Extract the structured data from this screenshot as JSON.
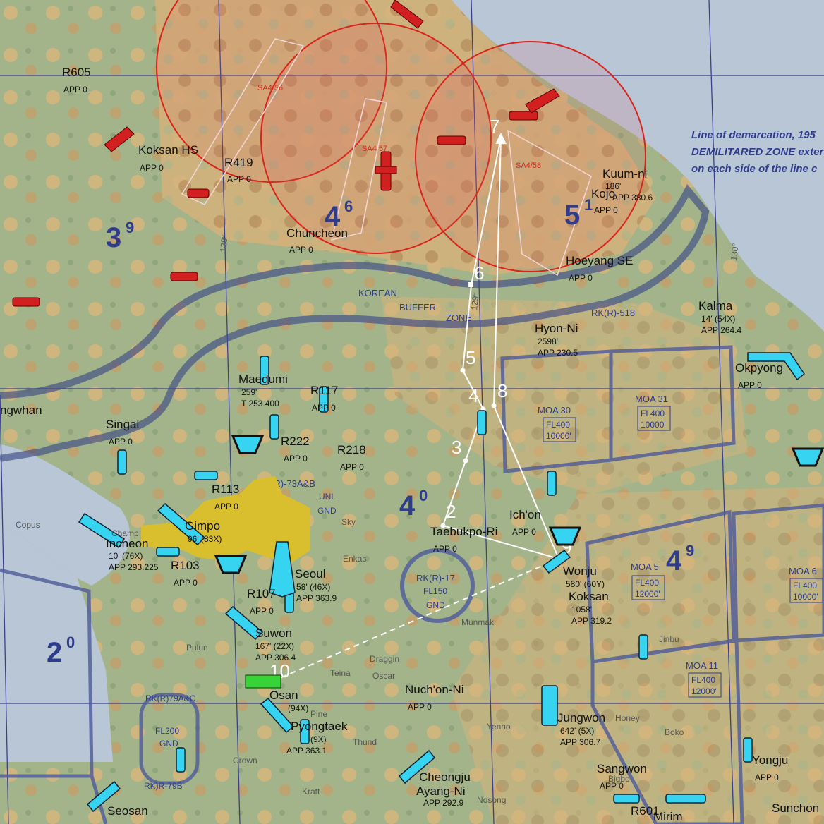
{
  "dmz_note": [
    "Line of demarcation, 195",
    "DEMILITARED ZONE exter",
    "on each side of the line c"
  ],
  "korean_buffer_zone": [
    "KOREAN",
    "BUFFER",
    "ZONE"
  ],
  "longitude_labels": [
    "128°",
    "129°",
    "130°"
  ],
  "zones": [
    {
      "big": "3",
      "sup": "9"
    },
    {
      "big": "4",
      "sup": "6"
    },
    {
      "big": "5",
      "sup": "1"
    },
    {
      "big": "4",
      "sup": "0"
    },
    {
      "big": "4",
      "sup": "9"
    },
    {
      "big": "2",
      "sup": "0"
    }
  ],
  "sam_sites": [
    "SA4/56",
    "SA4/57",
    "SA4/58"
  ],
  "waypoints": [
    "2",
    "3",
    "4",
    "5",
    "6",
    "7",
    "8",
    "9",
    "10"
  ],
  "airfields": [
    {
      "name": "R605",
      "info": "APP 0"
    },
    {
      "name": "Koksan HS",
      "info": "APP 0"
    },
    {
      "name": "R419",
      "info": "APP 0"
    },
    {
      "name": "Chuncheon",
      "info": "APP 0"
    },
    {
      "name": "Kuum-ni",
      "info": "186'"
    },
    {
      "name": "Kojo",
      "info": "APP 380.6"
    },
    {
      "name": "",
      "info": "APP 0"
    },
    {
      "name": "Hoeyang SE",
      "info": "APP 0"
    },
    {
      "name": "Kalma",
      "info": "14' (54X)"
    },
    {
      "name": "",
      "info": "APP 264.4"
    },
    {
      "name": "Hyon-Ni",
      "info": "2598'"
    },
    {
      "name": "",
      "info": "APP 230.5"
    },
    {
      "name": "Okpyong",
      "info": "APP 0"
    },
    {
      "name": "Maedumi",
      "info": "259'"
    },
    {
      "name": "",
      "info": "T 253.400"
    },
    {
      "name": "R117",
      "info": "APP 0"
    },
    {
      "name": "Singal",
      "info": "APP 0"
    },
    {
      "name": "R222",
      "info": "APP 0"
    },
    {
      "name": "R218",
      "info": "APP 0"
    },
    {
      "name": "R113",
      "info": "APP 0"
    },
    {
      "name": "Gimpo",
      "info": "96' (83X)"
    },
    {
      "name": "Incheon",
      "info": "10' (76X)"
    },
    {
      "name": "",
      "info": "APP 293.225"
    },
    {
      "name": "R103",
      "info": "APP 0"
    },
    {
      "name": "Seoul",
      "info": "58' (46X)"
    },
    {
      "name": "",
      "info": "APP 363.9"
    },
    {
      "name": "R107",
      "info": "APP 0"
    },
    {
      "name": "Suwon",
      "info": "167' (22X)"
    },
    {
      "name": "",
      "info": "APP 306.4"
    },
    {
      "name": "Osan",
      "info": "(94X)"
    },
    {
      "name": "Pyongtaek",
      "info": "(9X)"
    },
    {
      "name": "",
      "info": "APP 363.1"
    },
    {
      "name": "Taebukpo-Ri",
      "info": "APP 0"
    },
    {
      "name": "Ich'on",
      "info": "APP 0"
    },
    {
      "name": "Wonju",
      "info": "580' (60Y)"
    },
    {
      "name": "Koksan",
      "info": "1058'"
    },
    {
      "name": "",
      "info": "APP 319.2"
    },
    {
      "name": "Nuch'on-Ni",
      "info": "APP 0"
    },
    {
      "name": "Jungwon",
      "info": "642' (5X)"
    },
    {
      "name": "",
      "info": "APP 306.7"
    },
    {
      "name": "Cheongju",
      "info": "Ayang-Ni"
    },
    {
      "name": "",
      "info": "APP 292.9"
    },
    {
      "name": "Sangwon",
      "info": "APP 0"
    },
    {
      "name": "R601",
      "info": "Mirim"
    },
    {
      "name": "Yongju",
      "info": "APP 0"
    },
    {
      "name": "Seosan",
      "info": ""
    },
    {
      "name": "Sunchon",
      "info": ""
    },
    {
      "name": "ngwhan",
      "info": ""
    }
  ],
  "moas": [
    {
      "name": "MOA 30",
      "fl": "FL400",
      "alt": "10000'"
    },
    {
      "name": "MOA 31",
      "fl": "FL400",
      "alt": "10000'"
    },
    {
      "name": "MOA 5",
      "fl": "FL400",
      "alt": "12000'"
    },
    {
      "name": "MOA 6",
      "fl": "FL400",
      "alt": "10000'"
    },
    {
      "name": "MOA 11",
      "fl": "FL400",
      "alt": "12000'"
    }
  ],
  "restricted": [
    {
      "name": "RK(R)-518"
    },
    {
      "name": "RK(R)-17",
      "fl": "FL150",
      "lower": "GND"
    },
    {
      "name": "RK(R)-73A&B",
      "fl": "UNL",
      "lower": "GND"
    },
    {
      "name": "RK(R)79A&C",
      "fl": "FL200",
      "lower": "GND"
    },
    {
      "name": "RK)R-79B"
    }
  ],
  "town_labels": [
    "Copus",
    "Enkas",
    "Sky",
    "Pulun",
    "Draggin",
    "Teina",
    "Oscar",
    "Munmak",
    "Jinbu",
    "Boko",
    "Yenho",
    "Honey",
    "Thund",
    "Crown",
    "Kratt",
    "Pine",
    "Nosong",
    "Bigbo",
    "Champ"
  ]
}
